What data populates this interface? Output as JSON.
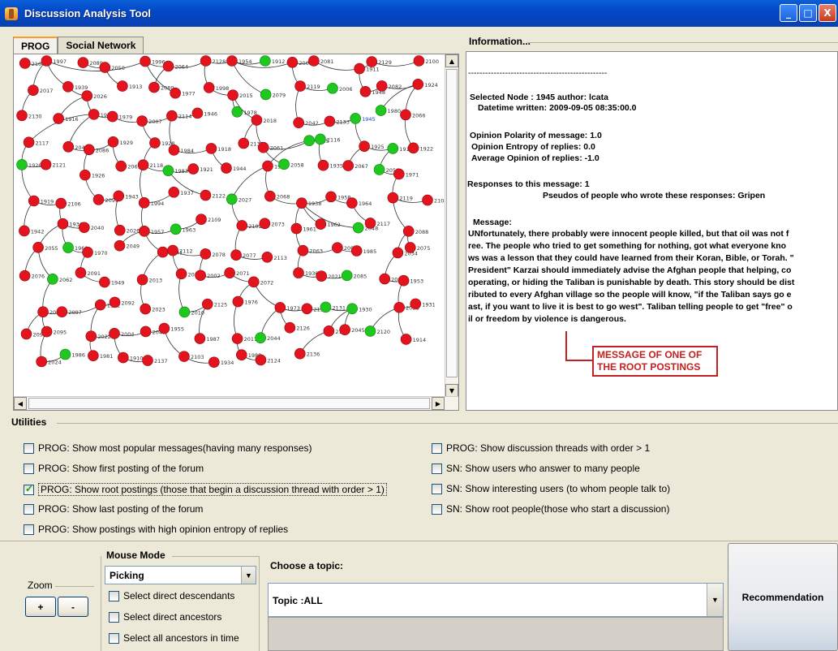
{
  "window": {
    "title": "Discussion Analysis Tool",
    "minimize": "_",
    "maximize": "□",
    "close": "X"
  },
  "tabs": [
    {
      "label": "PROG",
      "active": true
    },
    {
      "label": "Social Network",
      "active": false
    }
  ],
  "graph": {
    "node_colors": {
      "red": "#e3141e",
      "green": "#1ec81e",
      "edge": "#333333"
    },
    "selected_node": "1945",
    "nodes": [
      {
        "id": "2104",
        "c": "r"
      },
      {
        "id": "1997",
        "c": "r"
      },
      {
        "id": "2089",
        "c": "r"
      },
      {
        "id": "2050",
        "c": "r"
      },
      {
        "id": "1996",
        "c": "r"
      },
      {
        "id": "2064",
        "c": "r"
      },
      {
        "id": "2128",
        "c": "r"
      },
      {
        "id": "1954",
        "c": "r"
      },
      {
        "id": "1912",
        "c": "g"
      },
      {
        "id": "2009",
        "c": "r"
      },
      {
        "id": "2081",
        "c": "r"
      },
      {
        "id": "1911",
        "c": "r"
      },
      {
        "id": "2129",
        "c": "r"
      },
      {
        "id": "2100",
        "c": "r"
      },
      {
        "id": "2017",
        "c": "r"
      },
      {
        "id": "1939",
        "c": "r"
      },
      {
        "id": "2026",
        "c": "r"
      },
      {
        "id": "1913",
        "c": "r"
      },
      {
        "id": "2080",
        "c": "r"
      },
      {
        "id": "1977",
        "c": "r"
      },
      {
        "id": "1998",
        "c": "r"
      },
      {
        "id": "2015",
        "c": "r"
      },
      {
        "id": "2079",
        "c": "g"
      },
      {
        "id": "2119",
        "c": "r"
      },
      {
        "id": "2006",
        "c": "g"
      },
      {
        "id": "1948",
        "c": "r"
      },
      {
        "id": "2082",
        "c": "r"
      },
      {
        "id": "1924",
        "c": "r"
      },
      {
        "id": "2130",
        "c": "r"
      },
      {
        "id": "1916",
        "c": "r"
      },
      {
        "id": "1915",
        "c": "r"
      },
      {
        "id": "1979",
        "c": "r"
      },
      {
        "id": "2007",
        "c": "r"
      },
      {
        "id": "2114",
        "c": "r"
      },
      {
        "id": "1946",
        "c": "r"
      },
      {
        "id": "1978",
        "c": "g"
      },
      {
        "id": "2018",
        "c": "r"
      },
      {
        "id": "2042",
        "c": "r"
      },
      {
        "id": "2133",
        "c": "r"
      },
      {
        "id": "1945",
        "c": "g"
      },
      {
        "id": "1980",
        "c": "g"
      },
      {
        "id": "2066",
        "c": "r"
      },
      {
        "id": "2117",
        "c": "r"
      },
      {
        "id": "2043",
        "c": "r"
      },
      {
        "id": "2086",
        "c": "r"
      },
      {
        "id": "1929",
        "c": "r"
      },
      {
        "id": "1928",
        "c": "r"
      },
      {
        "id": "1984",
        "c": "r"
      },
      {
        "id": "1918",
        "c": "r"
      },
      {
        "id": "2132",
        "c": "r"
      },
      {
        "id": "2061",
        "c": "r"
      },
      {
        "id": "2065",
        "c": "g"
      },
      {
        "id": "2116",
        "c": "g"
      },
      {
        "id": "1925",
        "c": "r"
      },
      {
        "id": "1917",
        "c": "g"
      },
      {
        "id": "1922",
        "c": "r"
      },
      {
        "id": "1920",
        "c": "g"
      },
      {
        "id": "2121",
        "c": "r"
      },
      {
        "id": "1926",
        "c": "r"
      },
      {
        "id": "2069",
        "c": "r"
      },
      {
        "id": "2118",
        "c": "r"
      },
      {
        "id": "1983",
        "c": "g"
      },
      {
        "id": "1921",
        "c": "r"
      },
      {
        "id": "1944",
        "c": "r"
      },
      {
        "id": "1927",
        "c": "r"
      },
      {
        "id": "2058",
        "c": "g"
      },
      {
        "id": "1935",
        "c": "r"
      },
      {
        "id": "2067",
        "c": "r"
      },
      {
        "id": "2056",
        "c": "g"
      },
      {
        "id": "1971",
        "c": "r"
      },
      {
        "id": "1919",
        "c": "r"
      },
      {
        "id": "2106",
        "c": "r"
      },
      {
        "id": "2099",
        "c": "r"
      },
      {
        "id": "1943",
        "c": "r"
      },
      {
        "id": "1994",
        "c": "r"
      },
      {
        "id": "1937",
        "c": "r"
      },
      {
        "id": "2122",
        "c": "r"
      },
      {
        "id": "2027",
        "c": "g"
      },
      {
        "id": "2068",
        "c": "r"
      },
      {
        "id": "1938",
        "c": "r"
      },
      {
        "id": "1958",
        "c": "r"
      },
      {
        "id": "1964",
        "c": "r"
      },
      {
        "id": "2119b",
        "c": "r"
      },
      {
        "id": "2101",
        "c": "r"
      },
      {
        "id": "1942",
        "c": "r"
      },
      {
        "id": "1936",
        "c": "r"
      },
      {
        "id": "2040",
        "c": "r"
      },
      {
        "id": "2026b",
        "c": "r"
      },
      {
        "id": "1957",
        "c": "r"
      },
      {
        "id": "1963",
        "c": "g"
      },
      {
        "id": "2109",
        "c": "r"
      },
      {
        "id": "2102",
        "c": "r"
      },
      {
        "id": "2073",
        "c": "r"
      },
      {
        "id": "1961",
        "c": "r"
      },
      {
        "id": "1962",
        "c": "r"
      },
      {
        "id": "2048",
        "c": "g"
      },
      {
        "id": "2117b",
        "c": "r"
      },
      {
        "id": "2088",
        "c": "r"
      },
      {
        "id": "2055",
        "c": "r"
      },
      {
        "id": "1960",
        "c": "g"
      },
      {
        "id": "1970",
        "c": "r"
      },
      {
        "id": "2049",
        "c": "r"
      },
      {
        "id": "2041",
        "c": "r"
      },
      {
        "id": "2112",
        "c": "r"
      },
      {
        "id": "2078",
        "c": "r"
      },
      {
        "id": "2077",
        "c": "r"
      },
      {
        "id": "2113",
        "c": "r"
      },
      {
        "id": "2063",
        "c": "r"
      },
      {
        "id": "2090",
        "c": "r"
      },
      {
        "id": "1985",
        "c": "r"
      },
      {
        "id": "2034",
        "c": "r"
      },
      {
        "id": "2075",
        "c": "r"
      },
      {
        "id": "2076",
        "c": "r"
      },
      {
        "id": "2062",
        "c": "g"
      },
      {
        "id": "2091",
        "c": "r"
      },
      {
        "id": "1949",
        "c": "r"
      },
      {
        "id": "2013",
        "c": "r"
      },
      {
        "id": "2089b",
        "c": "r"
      },
      {
        "id": "2002",
        "c": "r"
      },
      {
        "id": "2071",
        "c": "r"
      },
      {
        "id": "2072",
        "c": "r"
      },
      {
        "id": "1936b",
        "c": "r"
      },
      {
        "id": "2021",
        "c": "r"
      },
      {
        "id": "2085",
        "c": "g"
      },
      {
        "id": "2094",
        "c": "r"
      },
      {
        "id": "1953",
        "c": "r"
      },
      {
        "id": "2046",
        "c": "r"
      },
      {
        "id": "2097",
        "c": "r"
      },
      {
        "id": "1932",
        "c": "r"
      },
      {
        "id": "2092",
        "c": "r"
      },
      {
        "id": "2023",
        "c": "r"
      },
      {
        "id": "2010",
        "c": "g"
      },
      {
        "id": "2125",
        "c": "r"
      },
      {
        "id": "1976",
        "c": "r"
      },
      {
        "id": "1973",
        "c": "r"
      },
      {
        "id": "2132b",
        "c": "r"
      },
      {
        "id": "2131",
        "c": "g"
      },
      {
        "id": "1930",
        "c": "g"
      },
      {
        "id": "2098",
        "c": "r"
      },
      {
        "id": "1931",
        "c": "r"
      },
      {
        "id": "2093",
        "c": "r"
      },
      {
        "id": "2095",
        "c": "r"
      },
      {
        "id": "2022",
        "c": "r"
      },
      {
        "id": "2004",
        "c": "r"
      },
      {
        "id": "2047",
        "c": "r"
      },
      {
        "id": "1955",
        "c": "r"
      },
      {
        "id": "1987",
        "c": "r"
      },
      {
        "id": "2011",
        "c": "r"
      },
      {
        "id": "2044",
        "c": "g"
      },
      {
        "id": "2126",
        "c": "r"
      },
      {
        "id": "2127",
        "c": "r"
      },
      {
        "id": "2045",
        "c": "r"
      },
      {
        "id": "2120",
        "c": "g"
      },
      {
        "id": "1914",
        "c": "r"
      },
      {
        "id": "2024",
        "c": "r"
      },
      {
        "id": "1986",
        "c": "g"
      },
      {
        "id": "1981",
        "c": "r"
      },
      {
        "id": "1910",
        "c": "r"
      },
      {
        "id": "2137",
        "c": "r"
      },
      {
        "id": "2103",
        "c": "r"
      },
      {
        "id": "1934",
        "c": "r"
      },
      {
        "id": "1988",
        "c": "r"
      },
      {
        "id": "2124",
        "c": "r"
      },
      {
        "id": "2136",
        "c": "r"
      }
    ]
  },
  "information": {
    "title": "Information...",
    "separator": "-------------------------------------------------",
    "selected_node": "Selected Node : 1945 author: lcata",
    "datetime": "Datetime written: 2009-09-05 08:35:00.0",
    "opinion_polarity": "Opinion Polarity of message: 1.0",
    "opinion_entropy": "Opinion Entropy of replies: 0.0",
    "average_opinion": "Average Opinion of replies: -1.0",
    "responses": "Responses to this message: 1",
    "pseudos": "Pseudos of people who wrote these responses:  Gripen",
    "message_label": "Message:",
    "message_lines": [
      " UNfortunately, there probably were innocent people killed, but that oil was not f",
      "ree. The people who tried to get something for nothing, got what everyone kno",
      "ws was a lesson that they could have learned from their Koran, Bible, or Torah. \"",
      "President\" Karzai should immediately advise the Afghan people that helping, co",
      "operating, or hiding the Taliban is punishable by death. This story should be dist",
      "ributed to every Afghan village so the people will know, \"if the Taliban says go e",
      "ast, if you want to live it is best to go west\". Taliban telling people to get \"free\" o",
      "il or freedom by violence is dangerous."
    ],
    "callout": [
      "MESSAGE OF ONE OF",
      "THE ROOT POSTINGS"
    ]
  },
  "utilities": {
    "title": "Utilities",
    "left": [
      {
        "label": "PROG: Show most popular messages(having many responses)",
        "checked": false
      },
      {
        "label": "PROG: Show first posting of the forum",
        "checked": false
      },
      {
        "label": "PROG: Show root postings (those that begin a discussion thread with order > 1)",
        "checked": true
      },
      {
        "label": "PROG: Show last posting of the forum",
        "checked": false
      },
      {
        "label": "PROG: Show postings with high opinion entropy of replies",
        "checked": false
      }
    ],
    "right": [
      {
        "label": "PROG: Show discussion threads with order > 1",
        "checked": false
      },
      {
        "label": "SN: Show users who answer to many people",
        "checked": false
      },
      {
        "label": "SN: Show interesting users (to whom people talk to)",
        "checked": false
      },
      {
        "label": "SN: Show root people(those who start a discussion)",
        "checked": false
      }
    ]
  },
  "zoom": {
    "label": "Zoom",
    "plus": "+",
    "minus": "-"
  },
  "mouse_mode": {
    "title": "Mouse Mode",
    "selected": "Picking",
    "options": [
      {
        "label": "Select direct descendants",
        "checked": false
      },
      {
        "label": "Select direct ancestors",
        "checked": false
      },
      {
        "label": "Select all ancestors in time",
        "checked": false
      }
    ]
  },
  "topic": {
    "title": "Choose a topic:",
    "selected": "Topic :ALL"
  },
  "recommendation": {
    "label": "Recommendation"
  }
}
